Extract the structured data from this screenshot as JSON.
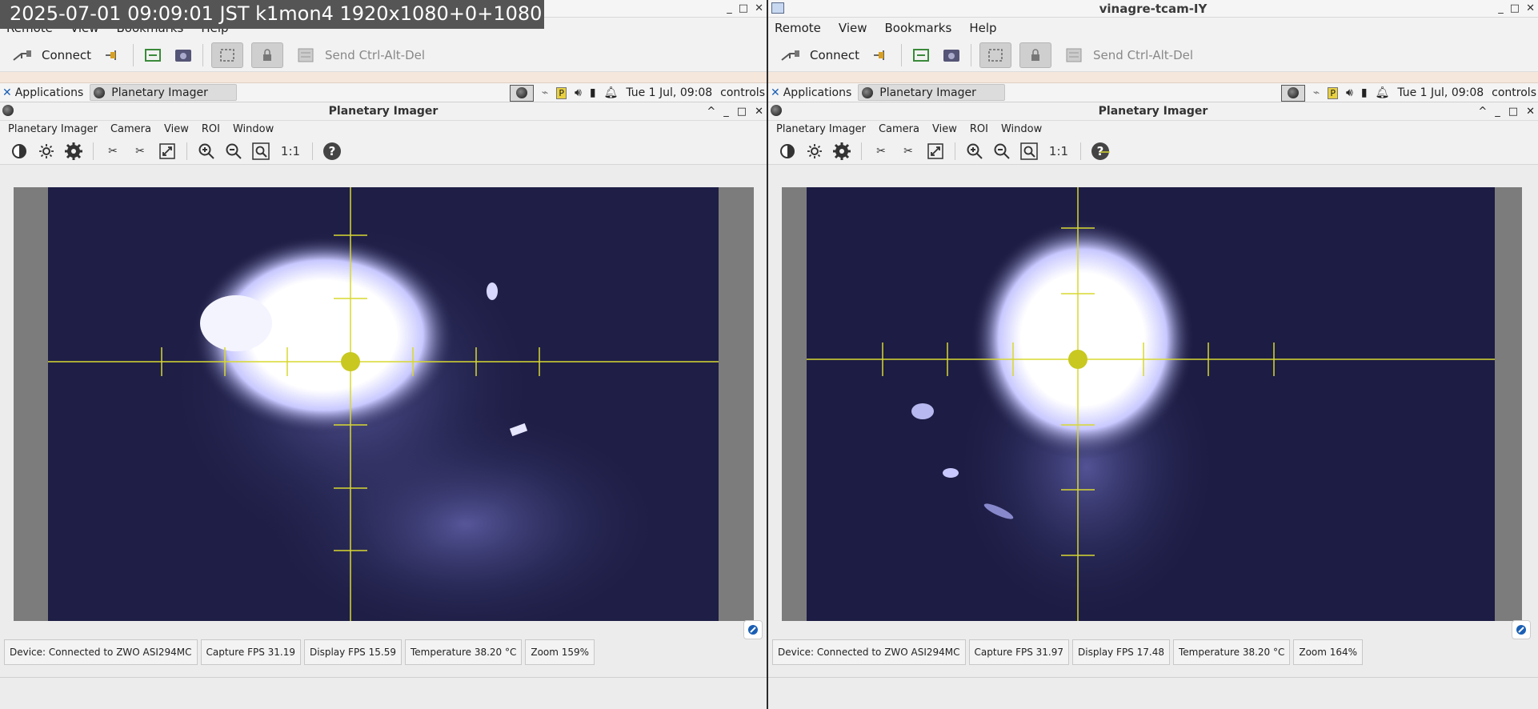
{
  "overlay": {
    "text": "2025-07-01 09:09:01 JST k1mon4 1920x1080+0+1080"
  },
  "screens": [
    {
      "window_title": "",
      "menu": [
        "Remote",
        "View",
        "Bookmarks",
        "Help"
      ],
      "toolbar": {
        "connect": "Connect",
        "ctrl_alt_del": "Send Ctrl-Alt-Del"
      },
      "panel": {
        "applications": "Applications",
        "task": "Planetary Imager",
        "clock": "Tue  1 Jul, 09:08",
        "user": "controls"
      },
      "app": {
        "title": "Planetary Imager",
        "menu": [
          "Planetary Imager",
          "Camera",
          "View",
          "ROI",
          "Window"
        ],
        "one_to_one": "1:1"
      },
      "status": {
        "device": "Device: Connected to ZWO ASI294MC",
        "capture_fps": "Capture FPS 31.19",
        "display_fps": "Display FPS 15.59",
        "temperature": "Temperature  38.20 °C",
        "zoom": "Zoom  159%"
      }
    },
    {
      "window_title": "vinagre-tcam-IY",
      "menu": [
        "Remote",
        "View",
        "Bookmarks",
        "Help"
      ],
      "toolbar": {
        "connect": "Connect",
        "ctrl_alt_del": "Send Ctrl-Alt-Del"
      },
      "panel": {
        "applications": "Applications",
        "task": "Planetary Imager",
        "clock": "Tue  1 Jul, 09:08",
        "user": "controls"
      },
      "app": {
        "title": "Planetary Imager",
        "menu": [
          "Planetary Imager",
          "Camera",
          "View",
          "ROI",
          "Window"
        ],
        "one_to_one": "1:1"
      },
      "status": {
        "device": "Device: Connected to ZWO ASI294MC",
        "capture_fps": "Capture FPS 31.97",
        "display_fps": "Display FPS 17.48",
        "temperature": "Temperature  38.20 °C",
        "zoom": "Zoom  164%"
      }
    }
  ],
  "colors": {
    "crosshair": "#d8d830",
    "image_bg": "#1c1c44",
    "glow": "#ffffff"
  },
  "icons": [
    "connect-icon",
    "plug-icon",
    "fullscreen-icon",
    "screenshot-icon",
    "scale-icon",
    "keyboard-icon",
    "ctrl-alt-del-icon",
    "contrast-icon",
    "brightness-icon",
    "settings-icon",
    "cut-icon",
    "scissors-icon",
    "expand-icon",
    "zoom-in-icon",
    "zoom-out-icon",
    "zoom-fit-icon",
    "help-icon"
  ]
}
